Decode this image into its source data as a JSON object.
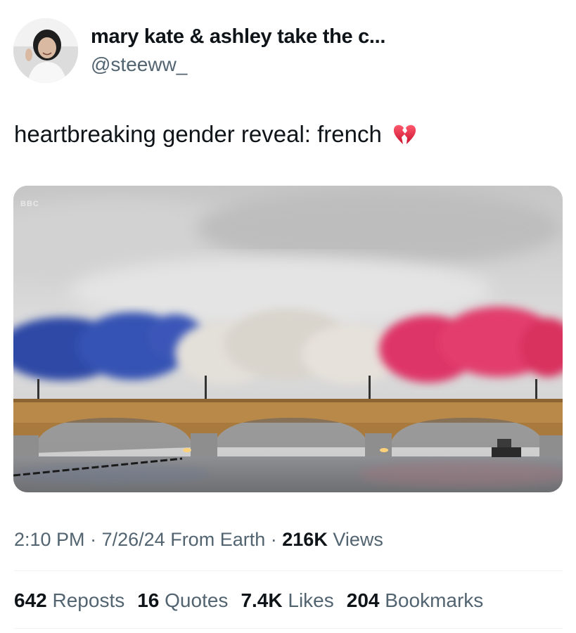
{
  "author": {
    "display_name": "mary kate & ashley take the c...",
    "handle": "@steeww_"
  },
  "tweet": {
    "text": "heartbreaking gender reveal: french",
    "emoji": "broken-heart-icon"
  },
  "media": {
    "watermark": "BBC",
    "alt_subject": "bridge with blue white red smoke"
  },
  "meta": {
    "time": "2:10 PM",
    "separator": "·",
    "date": "7/26/24",
    "source": "From Earth",
    "views_count": "216K",
    "views_label": "Views"
  },
  "stats": [
    {
      "count": "642",
      "label": "Reposts"
    },
    {
      "count": "16",
      "label": "Quotes"
    },
    {
      "count": "7.4K",
      "label": "Likes"
    },
    {
      "count": "204",
      "label": "Bookmarks"
    }
  ],
  "colors": {
    "text_primary": "#0f1419",
    "text_secondary": "#536471",
    "divider": "#eff3f4",
    "smoke_blue": "#2b4aa8",
    "smoke_white": "#e6e2dc",
    "smoke_red": "#e03a6a"
  }
}
